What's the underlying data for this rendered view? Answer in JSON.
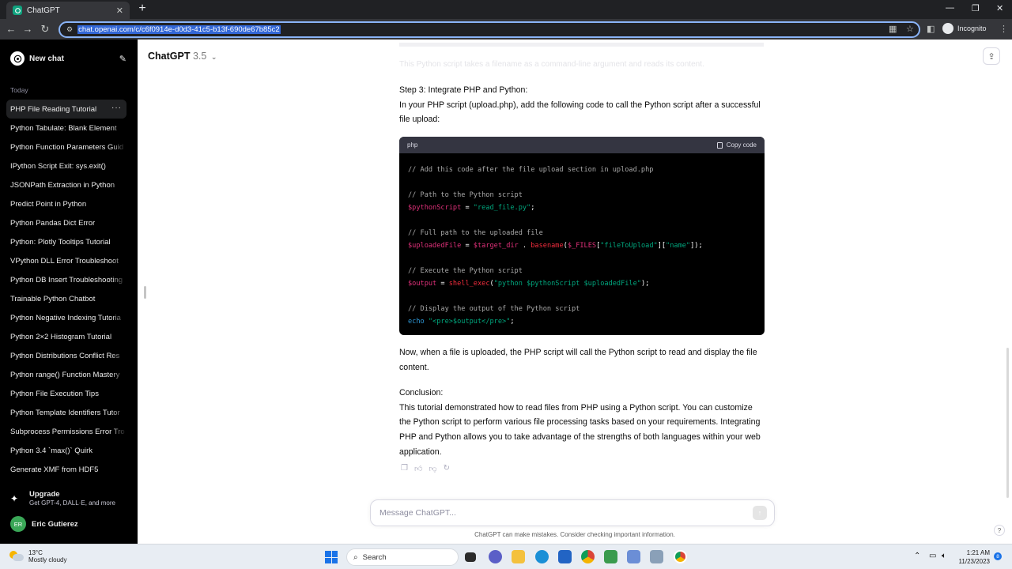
{
  "browser": {
    "tab_title": "ChatGPT",
    "url": "chat.openai.com/c/c6f0914e-d0d3-41c5-b13f-690de67b85c2",
    "incognito_label": "Incognito"
  },
  "sidebar": {
    "new_chat": "New chat",
    "section_today": "Today",
    "items": [
      "PHP File Reading Tutorial",
      "Python Tabulate: Blank Element",
      "Python Function Parameters Guid",
      "IPython Script Exit: sys.exit()",
      "JSONPath Extraction in Python",
      "Predict Point in Python",
      "Python Pandas Dict Error",
      "Python: Plotly Tooltips Tutorial",
      "VPython DLL Error Troubleshoot",
      "Python DB Insert Troubleshooting",
      "Trainable Python Chatbot",
      "Python Negative Indexing Tutoria",
      "Python 2×2 Histogram Tutorial",
      "Python Distributions Conflict Res",
      "Python range() Function Mastery",
      "Python File Execution Tips",
      "Python Template Identifiers Tutor",
      "Subprocess Permissions Error Tro",
      "Python 3.4 `max()` Quirk",
      "Generate XMF from HDF5"
    ],
    "upgrade_title": "Upgrade",
    "upgrade_sub": "Get GPT-4, DALL·E, and more",
    "user_initials": "ER",
    "user_name": "Eric Gutierez"
  },
  "header": {
    "model": "ChatGPT",
    "version": "3.5"
  },
  "message": {
    "faded_line": "This Python script takes a filename as a command-line argument and reads its content.",
    "step3_title": "Step 3: Integrate PHP and Python:",
    "step3_text": "In your PHP script (upload.php), add the following code to call the Python script after a successful file upload:",
    "code_lang": "php",
    "copy_label": "Copy code",
    "after_code": "Now, when a file is uploaded, the PHP script will call the Python script to read and display the file content.",
    "conclusion_title": "Conclusion:",
    "conclusion_text": "This tutorial demonstrated how to read files from PHP using a Python script. You can customize the Python script to perform various file processing tasks based on your requirements. Integrating PHP and Python allows you to take advantage of the strengths of both languages within your web application."
  },
  "code": {
    "c1": "// Add this code after the file upload section in upload.php",
    "c2": "// Path to the Python script",
    "v1": "$pythonScript",
    "s1": "\"read_file.py\"",
    "c3": "// Full path to the uploaded file",
    "v2": "$uploadedFile",
    "v3": "$target_dir",
    "f1": "basename",
    "v4": "$_FILES",
    "s2": "\"fileToUpload\"",
    "s3": "\"name\"",
    "c4": "// Execute the Python script",
    "v5": "$output",
    "f2": "shell_exec",
    "s4": "\"python $pythonScript $uploadedFile\"",
    "c5": "// Display the output of the Python script",
    "k1": "echo",
    "s5": "\"<pre>$output</pre>\""
  },
  "composer": {
    "placeholder": "Message ChatGPT..."
  },
  "footer": {
    "disclaimer": "ChatGPT can make mistakes. Consider checking important information.",
    "help": "?"
  },
  "taskbar": {
    "temp": "13°C",
    "weather": "Mostly cloudy",
    "search": "Search",
    "time": "1:21 AM",
    "date": "11/23/2023",
    "notif_count": "8"
  }
}
